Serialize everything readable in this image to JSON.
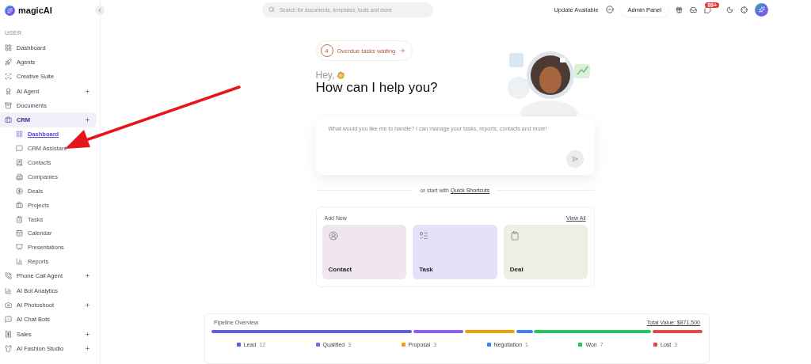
{
  "sidebar": {
    "logo": "magicAI",
    "section": "USER",
    "items": [
      {
        "label": "Dashboard",
        "selected": false,
        "expandable": false
      },
      {
        "label": "Agents",
        "selected": false,
        "expandable": false
      },
      {
        "label": "Creative Suite",
        "selected": false,
        "expandable": false
      },
      {
        "label": "AI Agent",
        "selected": false,
        "expandable": true
      },
      {
        "label": "Documents",
        "selected": false,
        "expandable": false
      },
      {
        "label": "CRM",
        "selected": true,
        "expandable": true,
        "children": [
          {
            "label": "Dashboard",
            "selected": true
          },
          {
            "label": "CRM Assistant",
            "selected": false
          },
          {
            "label": "Contacts",
            "selected": false
          },
          {
            "label": "Companies",
            "selected": false
          },
          {
            "label": "Deals",
            "selected": false
          },
          {
            "label": "Projects",
            "selected": false
          },
          {
            "label": "Tasks",
            "selected": false
          },
          {
            "label": "Calendar",
            "selected": false
          },
          {
            "label": "Presentations",
            "selected": false
          },
          {
            "label": "Reports",
            "selected": false
          }
        ]
      },
      {
        "label": "Phone Call Agent",
        "selected": false,
        "expandable": true
      },
      {
        "label": "AI Bot Analytics",
        "selected": false,
        "expandable": false
      },
      {
        "label": "AI Photoshoot",
        "selected": false,
        "expandable": true
      },
      {
        "label": "AI Chat Bots",
        "selected": false,
        "expandable": false
      },
      {
        "label": "Sales",
        "selected": false,
        "expandable": true
      },
      {
        "label": "AI Fashion Studio",
        "selected": false,
        "expandable": true
      }
    ]
  },
  "topbar": {
    "search": {
      "placeholder": "Search for documents, templates, tools and more"
    },
    "update": "Update Available",
    "admin": "Admin Panel",
    "notification_badge": "99+"
  },
  "hero": {
    "overdue": {
      "count": "4",
      "label": "Overdue tasks waiting"
    },
    "greeting": "Hey,",
    "title": "How can I help you?",
    "prompt": {
      "placeholder": "What would you like me to handle? I can manage your tasks, reports, contacts and more!"
    },
    "shortcuts_text": "or start with",
    "shortcuts_link": "Quick Shortcuts"
  },
  "add_new": {
    "title": "Add New",
    "view_all": "View All",
    "tiles": [
      {
        "label": "Contact",
        "color": "#efe6ef"
      },
      {
        "label": "Task",
        "color": "#e4e2f8"
      },
      {
        "label": "Deal",
        "color": "#efeee4"
      }
    ]
  },
  "pipeline": {
    "title": "Pipeline Overview",
    "total": "Total Value: $871,500",
    "stages": [
      {
        "name": "Lead",
        "count": "12",
        "color": "#5b5fe6"
      },
      {
        "name": "Qualified",
        "count": "3",
        "color": "#8b5cf6"
      },
      {
        "name": "Proposal",
        "count": "3",
        "color": "#f59e0b"
      },
      {
        "name": "Negotiation",
        "count": "1",
        "color": "#3b82f6"
      },
      {
        "name": "Won",
        "count": "7",
        "color": "#22c55e"
      },
      {
        "name": "Lost",
        "count": "3",
        "color": "#ef4444"
      }
    ]
  }
}
